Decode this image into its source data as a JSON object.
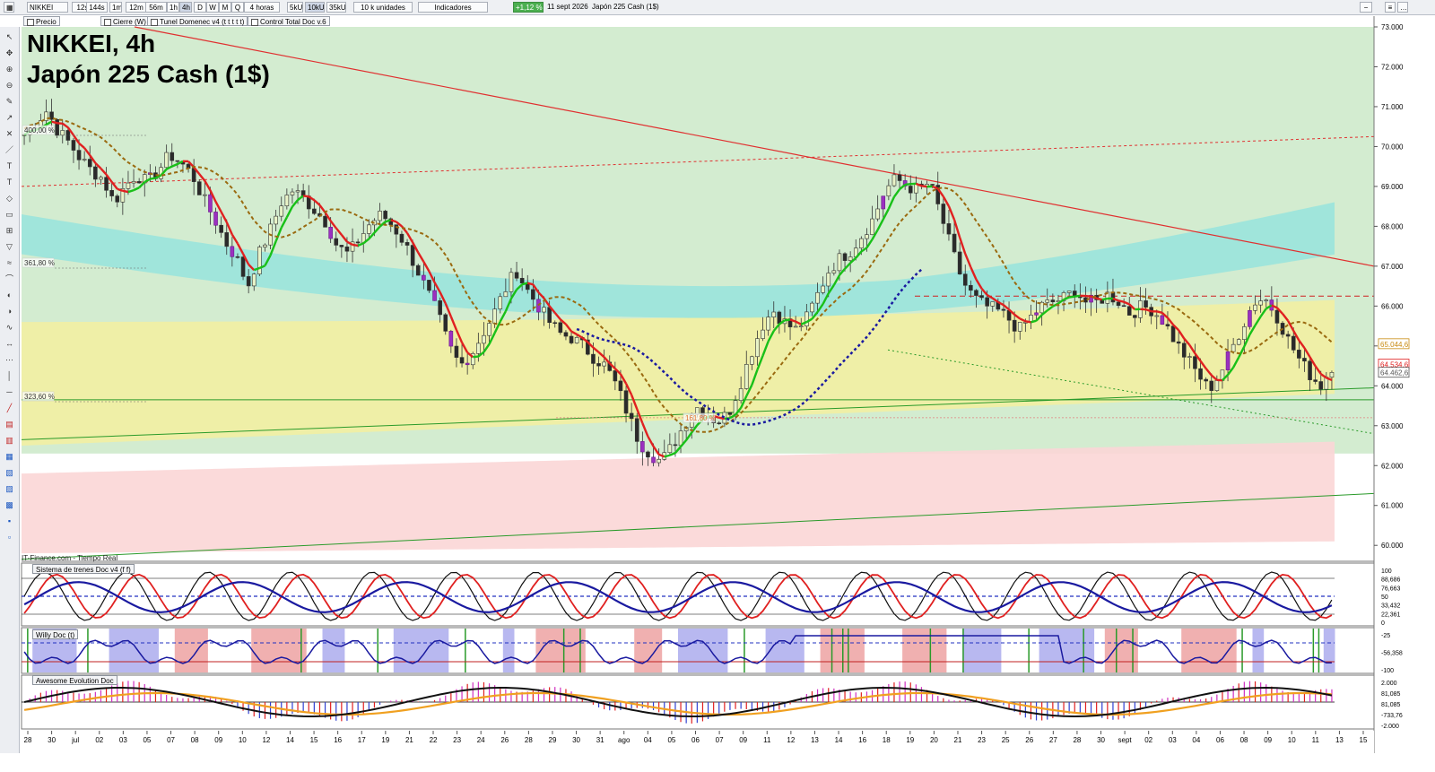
{
  "toolbar": {
    "symbol": "NIKKEI",
    "timeframes": [
      "12s",
      "144s",
      "1m",
      "12m",
      "56m",
      "1h",
      "4h",
      "D",
      "W",
      "M",
      "Q"
    ],
    "active_timeframe": "4h",
    "period": "4 horas",
    "sizes": [
      "5kU",
      "10kU",
      "35kU"
    ],
    "active_size": "10kU",
    "units": "10 k unidades",
    "indicators": "Indicadores",
    "change": "+1,12 %",
    "date": "11 sept 2026",
    "instrument": "Japón 225 Cash (1$)"
  },
  "legend_row": {
    "items": [
      "Precio",
      "Cierre (W)",
      "Tunel Domenec v4 (t t t t t)",
      "Control Total Doc v.6"
    ]
  },
  "main_title": {
    "line1": "NIKKEI, 4h",
    "line2": "Japón 225 Cash (1$)"
  },
  "source": "IT-Finance.com - Tiempo Real",
  "fib_labels": [
    "400,00 %",
    "361,80 %",
    "323,60 %",
    "161,80 %"
  ],
  "price_tags": [
    "65.044,6",
    "64.534,6",
    "64.462,6"
  ],
  "panels": [
    {
      "title": "Sistema de trenes Doc v4 (f f)",
      "axis": [
        "100",
        "88,686",
        "76,663",
        "50",
        "33,432",
        "22,361",
        "0"
      ]
    },
    {
      "title": "Willy Doc (t)",
      "axis": [
        "-25",
        "-56,358",
        "-100"
      ]
    },
    {
      "title": "Awesome Evolution Doc",
      "axis": [
        "2.000",
        "81,085",
        "81,085",
        "-733,76",
        "-2.000"
      ]
    }
  ],
  "colors": {
    "up_candle": "#3aa13a",
    "down_candle": "#2a2a2a",
    "accent_red": "#e02020",
    "accent_green": "#18c018",
    "accent_blue": "#1a1aa0",
    "brown_dash": "#9a6a10"
  },
  "chart_data": {
    "type": "candlestick",
    "title": "NIKKEI, 4h",
    "subtitle": "Japón 225 Cash (1$)",
    "ylim": [
      59600,
      73000
    ],
    "y_ticks": [
      "73.000",
      "72.000",
      "71.000",
      "70.000",
      "69.000",
      "68.000",
      "67.000",
      "66.000",
      "65.000",
      "64.000",
      "63.000",
      "62.000",
      "61.000",
      "60.000"
    ],
    "x_ticks": [
      "28",
      "30",
      "jul",
      "02",
      "03",
      "05",
      "07",
      "08",
      "09",
      "10",
      "12",
      "14",
      "15",
      "16",
      "17",
      "19",
      "21",
      "22",
      "23",
      "24",
      "26",
      "28",
      "29",
      "30",
      "31",
      "ago",
      "04",
      "05",
      "06",
      "07",
      "09",
      "11",
      "12",
      "13",
      "14",
      "16",
      "18",
      "19",
      "20",
      "21",
      "23",
      "25",
      "26",
      "27",
      "28",
      "30",
      "sept",
      "02",
      "03",
      "04",
      "06",
      "08",
      "09",
      "10",
      "11",
      "13",
      "15"
    ],
    "close_path": [
      70300,
      70600,
      70900,
      70400,
      70100,
      69700,
      69400,
      69200,
      68600,
      69000,
      69300,
      69100,
      69400,
      69800,
      69600,
      69300,
      68700,
      68200,
      67600,
      67200,
      66500,
      67300,
      67900,
      68600,
      68900,
      68700,
      68400,
      68100,
      67500,
      67300,
      67700,
      68100,
      68300,
      68000,
      67600,
      67000,
      66400,
      65800,
      65000,
      64500,
      64800,
      65300,
      65800,
      66400,
      66900,
      66400,
      66000,
      65600,
      65300,
      65200,
      65000,
      64700,
      64500,
      64000,
      63300,
      62600,
      62300,
      62100,
      62500,
      63000,
      63500,
      63300,
      63100,
      63300,
      64000,
      64800,
      65500,
      65900,
      65600,
      65400,
      65700,
      66300,
      66900,
      67200,
      67400,
      67800,
      68200,
      68900,
      69200,
      69000,
      68900,
      69100,
      68300,
      67400,
      66600,
      66200,
      66000,
      65900,
      65700,
      65400,
      65700,
      66000,
      66100,
      66200,
      66400,
      66100,
      66100,
      66300,
      66100,
      65800,
      66000,
      65900,
      65600,
      65100,
      64700,
      64300,
      63900,
      64300,
      64900,
      65500,
      66100,
      66200,
      65800,
      65200,
      64700,
      64300,
      64000,
      64500
    ],
    "series": [
      {
        "type": "line",
        "style": "solid",
        "color": "#e02020/#18c018"
      },
      {
        "type": "line",
        "style": "dashed",
        "color": "#9a6a10"
      },
      {
        "type": "line",
        "style": "dotted",
        "color": "#1a1aa0"
      }
    ]
  }
}
